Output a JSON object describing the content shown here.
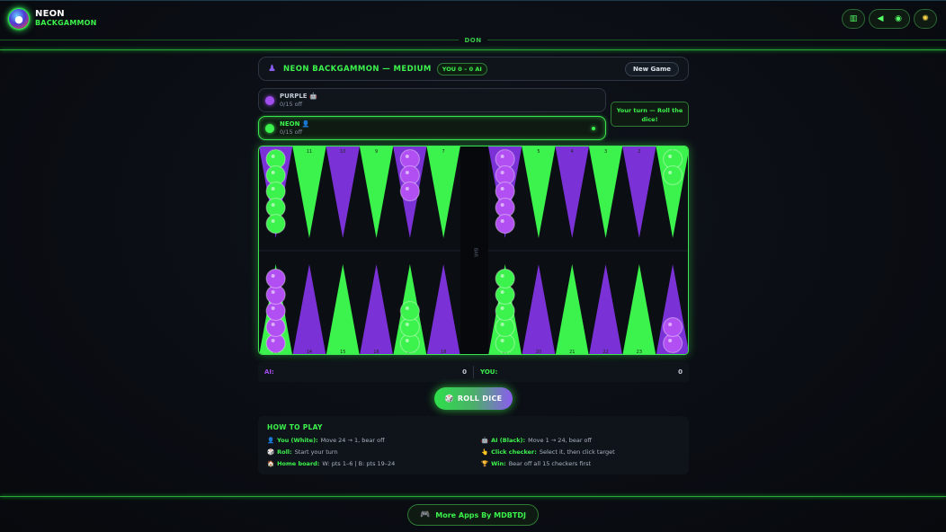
{
  "app": {
    "title": "NEON",
    "subtitle": "BACKGAMMON",
    "banner": "DON"
  },
  "toolbar": {
    "icons": [
      "book-icon",
      "volume-icon",
      "palette-icon",
      "sun-icon"
    ]
  },
  "header": {
    "title": "NEON BACKGAMMON — MEDIUM",
    "score": "YOU 0 – 0 AI",
    "new_game": "New Game"
  },
  "players": [
    {
      "name": "PURPLE 🤖",
      "off": "0/15 off",
      "color": "#a24df0",
      "active": false
    },
    {
      "name": "NEON 👤",
      "off": "0/15 off",
      "color": "#3cf24c",
      "active": true
    }
  ],
  "turn_message": "Your turn — Roll the dice!",
  "board": {
    "colors": {
      "green": "#3cf24c",
      "purple": "#7a32d6",
      "purple_checker": "#b24ff2",
      "green_checker": "#3cf24c"
    },
    "top_labels": [
      "12",
      "11",
      "10",
      "9",
      "8",
      "7",
      "6",
      "5",
      "4",
      "3",
      "2",
      "1"
    ],
    "bottom_labels": [
      "13",
      "14",
      "15",
      "16",
      "17",
      "18",
      "19",
      "20",
      "21",
      "22",
      "23",
      "24"
    ],
    "bar_text": "BAR",
    "top_points": [
      {
        "color": "green",
        "count": 5
      },
      {
        "color": "",
        "count": 0
      },
      {
        "color": "",
        "count": 0
      },
      {
        "color": "",
        "count": 0
      },
      {
        "color": "purple",
        "count": 3
      },
      {
        "color": "",
        "count": 0
      },
      {
        "color": "purple",
        "count": 5
      },
      {
        "color": "",
        "count": 0
      },
      {
        "color": "",
        "count": 0
      },
      {
        "color": "",
        "count": 0
      },
      {
        "color": "",
        "count": 0
      },
      {
        "color": "green",
        "count": 2
      }
    ],
    "bottom_points": [
      {
        "color": "purple",
        "count": 5
      },
      {
        "color": "",
        "count": 0
      },
      {
        "color": "",
        "count": 0
      },
      {
        "color": "",
        "count": 0
      },
      {
        "color": "green",
        "count": 3
      },
      {
        "color": "",
        "count": 0
      },
      {
        "color": "green",
        "count": 5
      },
      {
        "color": "",
        "count": 0
      },
      {
        "color": "",
        "count": 0
      },
      {
        "color": "",
        "count": 0
      },
      {
        "color": "",
        "count": 0
      },
      {
        "color": "purple",
        "count": 2
      }
    ]
  },
  "score_row": {
    "ai_label": "AI:",
    "ai_value": "0",
    "you_label": "YOU:",
    "you_value": "0"
  },
  "roll_button": {
    "icon": "🎲",
    "label": "ROLL DICE"
  },
  "how_to_play": {
    "title": "HOW TO PLAY",
    "items": [
      {
        "icon": "👤",
        "key": "You (White):",
        "text": "Move 24 → 1, bear off"
      },
      {
        "icon": "🤖",
        "key": "AI (Black):",
        "text": "Move 1 → 24, bear off"
      },
      {
        "icon": "🎲",
        "key": "Roll:",
        "text": "Start your turn"
      },
      {
        "icon": "👆",
        "key": "Click checker:",
        "text": "Select it, then click target"
      },
      {
        "icon": "🏠",
        "key": "Home board:",
        "text": "W: pts 1–6 | B: pts 19–24"
      },
      {
        "icon": "🏆",
        "key": "Win:",
        "text": "Bear off all 15 checkers first"
      }
    ]
  },
  "footer": {
    "button_icon": "🎮",
    "button_label": "More Apps By MDBTDJ"
  }
}
